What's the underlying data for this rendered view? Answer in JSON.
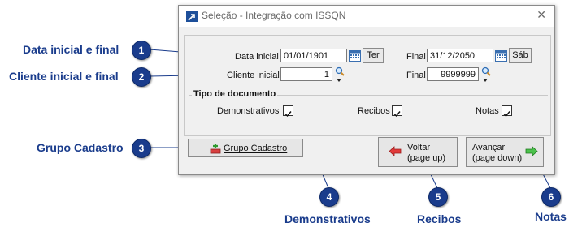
{
  "annotations": {
    "items": [
      {
        "number": "1",
        "label": "Data inicial e final"
      },
      {
        "number": "2",
        "label": "Cliente inicial e final"
      },
      {
        "number": "3",
        "label": "Grupo Cadastro"
      },
      {
        "number": "4",
        "label": "Demonstrativos"
      },
      {
        "number": "5",
        "label": "Recibos"
      },
      {
        "number": "6",
        "label": "Notas"
      }
    ]
  },
  "dialog": {
    "title": "Seleção - Integração com ISSQN",
    "close_glyph": "✕",
    "data_inicial_label": "Data inicial",
    "data_inicial_value": "01/01/1901",
    "data_inicial_day": "Ter",
    "data_final_label": "Final",
    "data_final_value": "31/12/2050",
    "data_final_day": "Sáb",
    "cliente_inicial_label": "Cliente inicial",
    "cliente_inicial_value": "1",
    "cliente_final_label": "Final",
    "cliente_final_value": "9999999",
    "tipo_documento_title": "Tipo de documento",
    "demonstrativos_label": "Demonstrativos",
    "demonstrativos_checked": true,
    "recibos_label": "Recibos",
    "recibos_checked": true,
    "notas_label": "Notas",
    "notas_checked": true,
    "grupo_cadastro_label": "Grupo Cadastro",
    "voltar_line1": "Voltar",
    "voltar_line2": "(page up)",
    "avancar_line1": "Avançar",
    "avancar_line2": "(page down)"
  },
  "colors": {
    "annotation": "#1a3c8c",
    "dialog_bg": "#f0f0f0"
  },
  "icons": [
    "app-icon",
    "calendar-icon",
    "search-icon",
    "dropdown-arrow-icon",
    "close-icon",
    "add-group-icon",
    "back-arrow-icon",
    "forward-arrow-icon",
    "check-icon"
  ]
}
